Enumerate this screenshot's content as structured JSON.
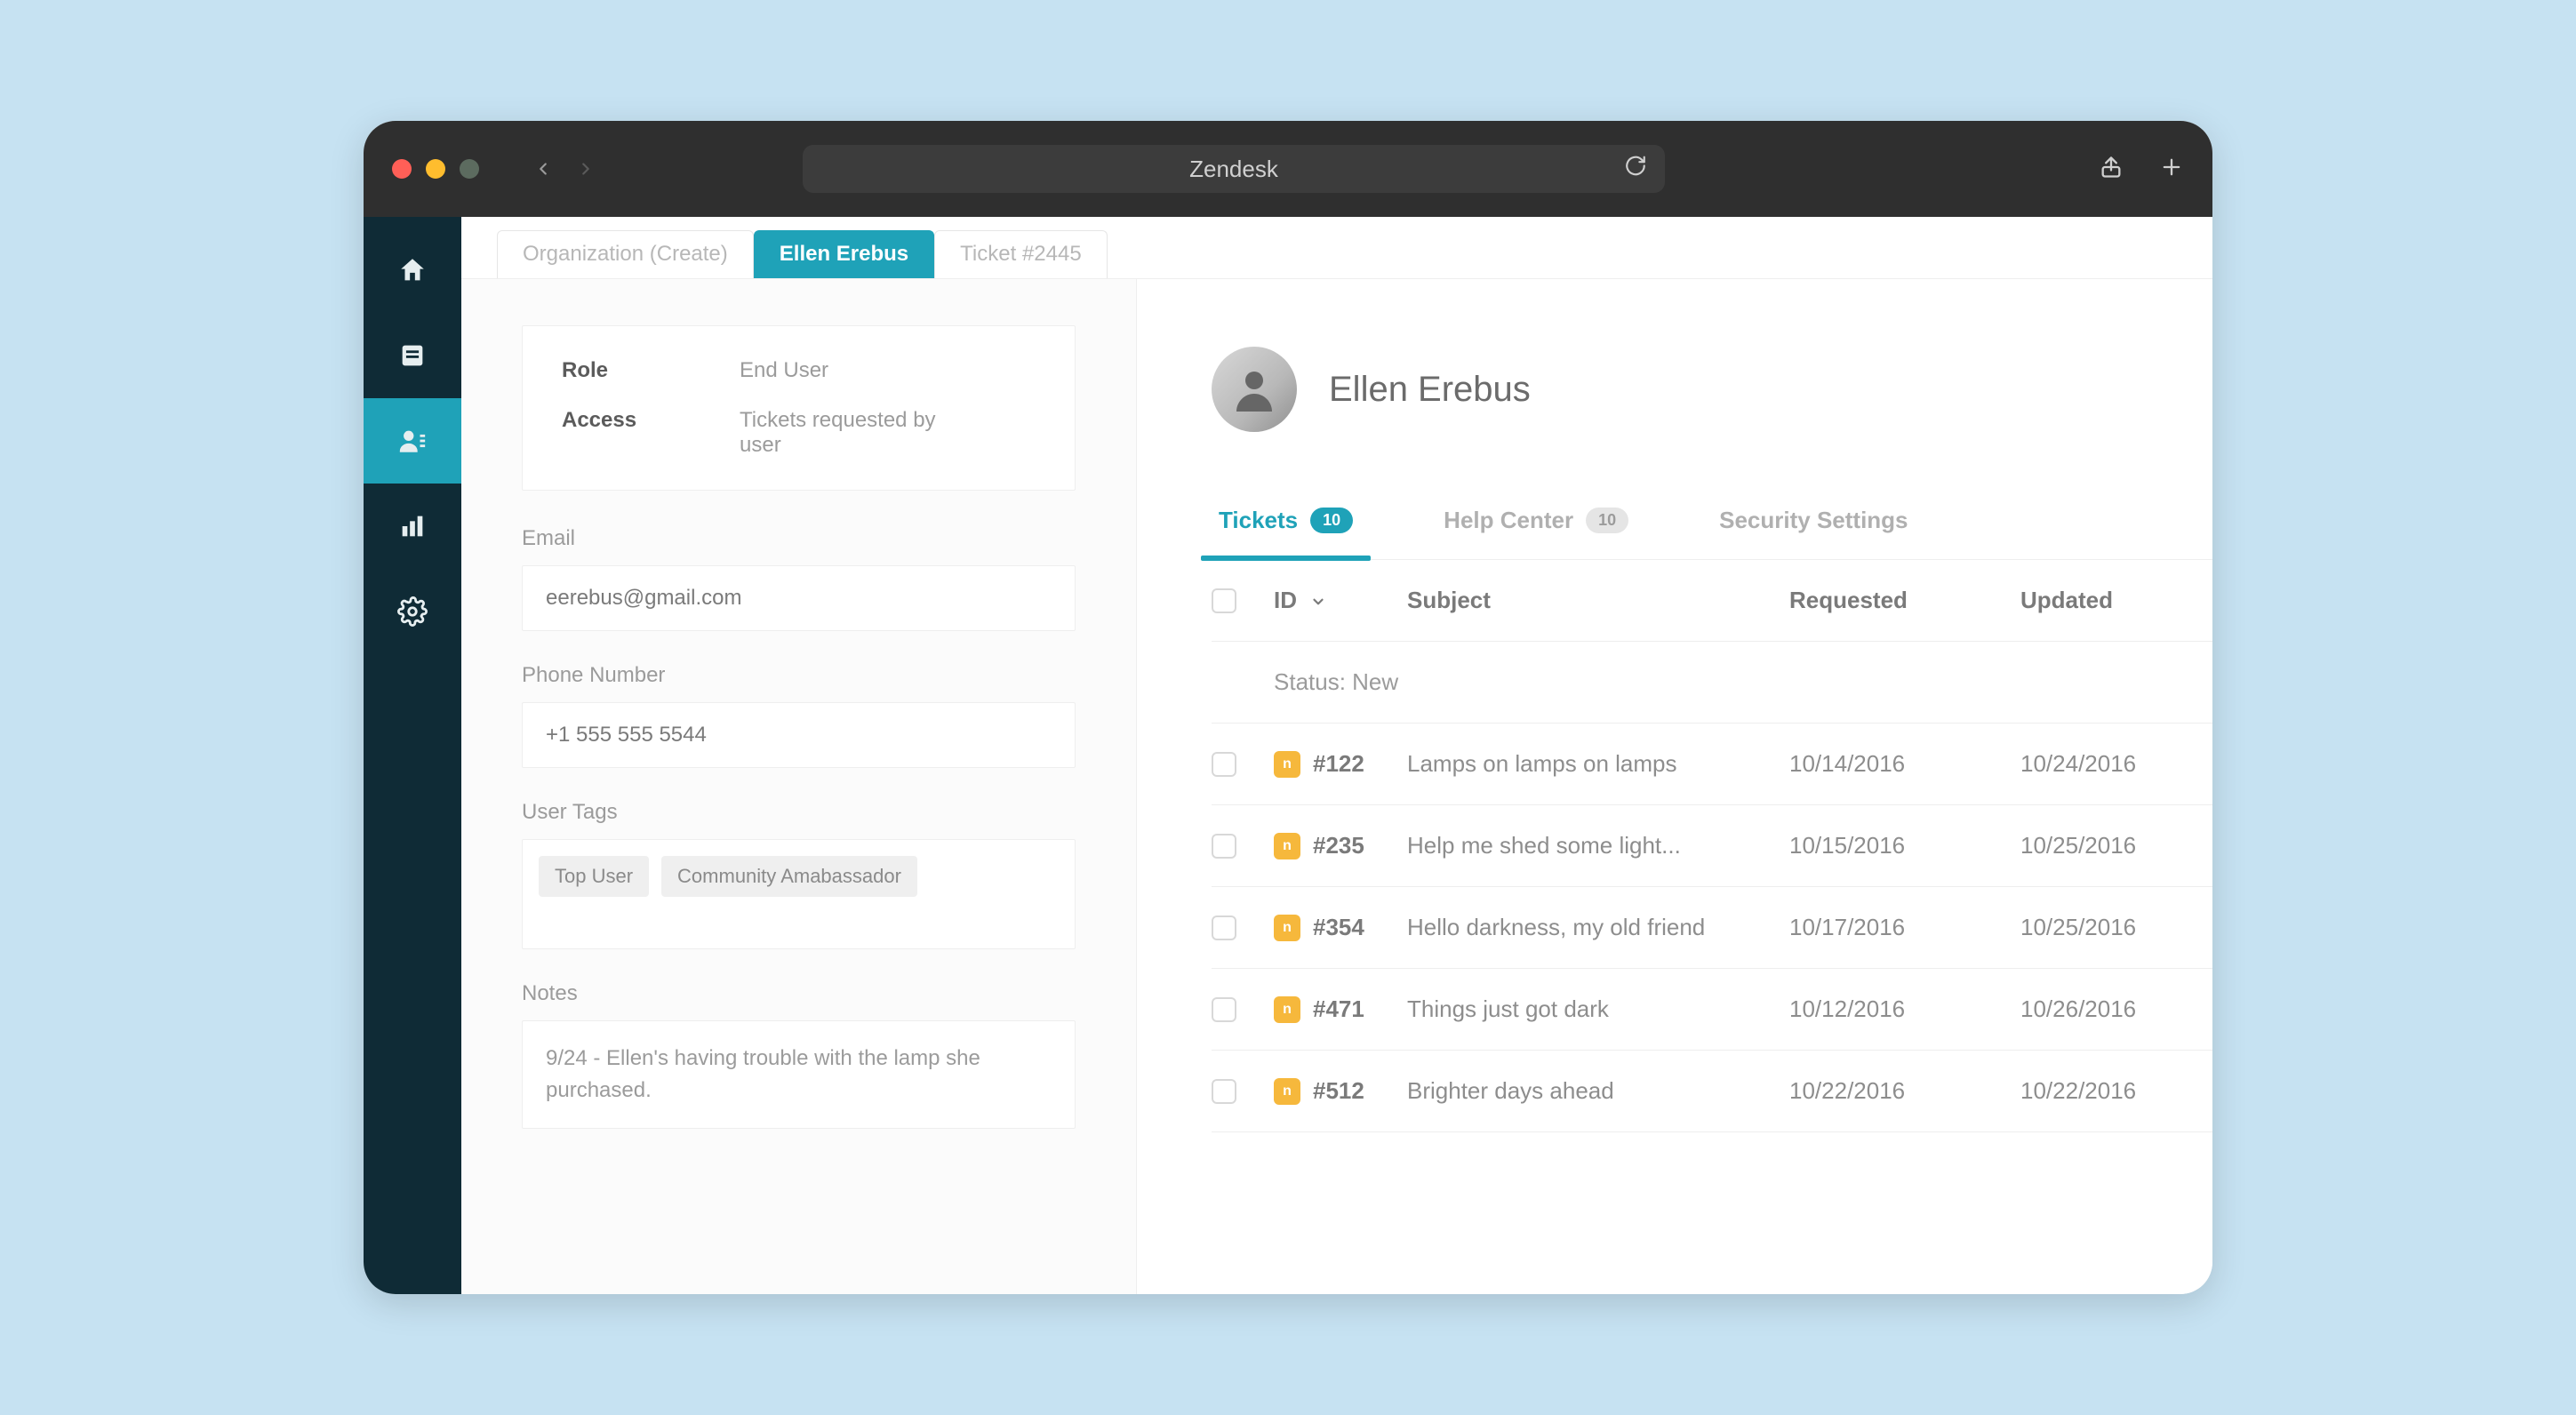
{
  "browser": {
    "title": "Zendesk"
  },
  "sidebar": {
    "items": [
      {
        "name": "home"
      },
      {
        "name": "views"
      },
      {
        "name": "customers"
      },
      {
        "name": "reports"
      },
      {
        "name": "settings"
      }
    ],
    "active_index": 2
  },
  "tabs": [
    {
      "label": "Organization (Create)",
      "active": false
    },
    {
      "label": "Ellen Erebus",
      "active": true
    },
    {
      "label": "Ticket #2445",
      "active": false
    }
  ],
  "profile": {
    "role_label": "Role",
    "role_value": "End User",
    "access_label": "Access",
    "access_value": "Tickets requested by user",
    "email_label": "Email",
    "email_value": "eerebus@gmail.com",
    "phone_label": "Phone Number",
    "phone_value": "+1 555 555 5544",
    "tags_label": "User Tags",
    "tags": [
      "Top User",
      "Community Amabassador"
    ],
    "notes_label": "Notes",
    "notes_value": "9/24 - Ellen's having trouble with the lamp she purchased."
  },
  "user": {
    "name": "Ellen Erebus"
  },
  "sub_tabs": {
    "tickets_label": "Tickets",
    "tickets_badge": "10",
    "help_label": "Help Center",
    "help_badge": "10",
    "security_label": "Security Settings"
  },
  "table": {
    "headers": {
      "id": "ID",
      "subject": "Subject",
      "requested": "Requested",
      "updated": "Updated"
    },
    "status_row": "Status: New",
    "rows": [
      {
        "id": "#122",
        "subject": "Lamps on lamps on lamps",
        "requested": "10/14/2016",
        "updated": "10/24/2016"
      },
      {
        "id": "#235",
        "subject": "Help me shed some light...",
        "requested": "10/15/2016",
        "updated": "10/25/2016"
      },
      {
        "id": "#354",
        "subject": "Hello darkness, my old friend",
        "requested": "10/17/2016",
        "updated": "10/25/2016"
      },
      {
        "id": "#471",
        "subject": "Things just got dark",
        "requested": "10/12/2016",
        "updated": "10/26/2016"
      },
      {
        "id": "#512",
        "subject": "Brighter days ahead",
        "requested": "10/22/2016",
        "updated": "10/22/2016"
      }
    ]
  }
}
